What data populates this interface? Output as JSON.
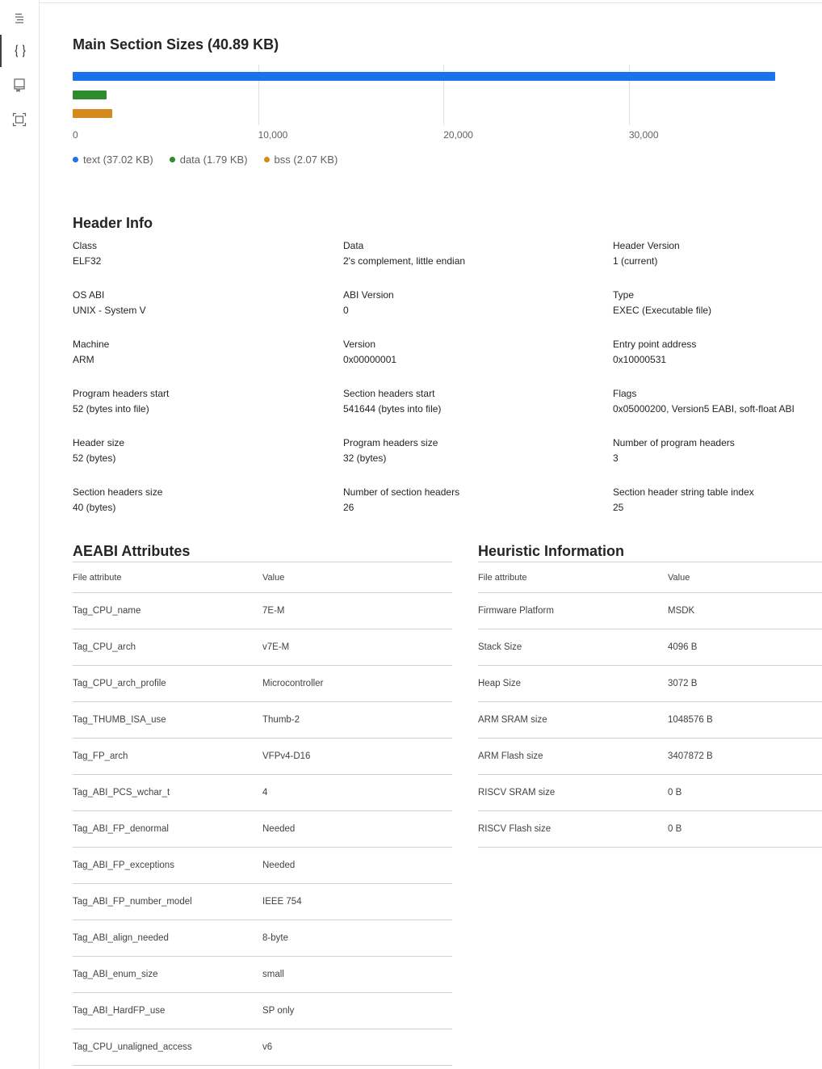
{
  "activity_bar": {
    "items": [
      {
        "name": "outline-icon"
      },
      {
        "name": "braces-icon"
      },
      {
        "name": "book-icon"
      },
      {
        "name": "fullscreen-icon"
      }
    ]
  },
  "section_sizes": {
    "title": "Main Section Sizes (40.89 KB)",
    "legend": [
      {
        "label": "text (37.02 KB)",
        "color": "#1a73e8"
      },
      {
        "label": "data (1.79 KB)",
        "color": "#2e8b2e"
      },
      {
        "label": "bss (2.07 KB)",
        "color": "#d48a1c"
      }
    ]
  },
  "chart_data": {
    "type": "bar",
    "orientation": "horizontal",
    "title": "Main Section Sizes (40.89 KB)",
    "categories": [
      "text",
      "data",
      "bss"
    ],
    "values": [
      37905,
      1833,
      2120
    ],
    "colors": [
      "#1a73e8",
      "#2e8b2e",
      "#d48a1c"
    ],
    "xlim": [
      0,
      38500
    ],
    "xticks": [
      "0",
      "10,000",
      "20,000",
      "30,000"
    ],
    "xtick_values": [
      0,
      10000,
      20000,
      30000
    ],
    "grid": true,
    "legend": "bottom-left"
  },
  "header_info": {
    "title": "Header Info",
    "fields": [
      {
        "label": "Class",
        "value": "ELF32"
      },
      {
        "label": "Data",
        "value": "2's complement, little endian"
      },
      {
        "label": "Header Version",
        "value": "1 (current)"
      },
      {
        "label": "OS ABI",
        "value": "UNIX - System V"
      },
      {
        "label": "ABI Version",
        "value": "0"
      },
      {
        "label": "Type",
        "value": "EXEC (Executable file)"
      },
      {
        "label": "Machine",
        "value": "ARM"
      },
      {
        "label": "Version",
        "value": "0x00000001"
      },
      {
        "label": "Entry point address",
        "value": "0x10000531"
      },
      {
        "label": "Program headers start",
        "value": "52 (bytes into file)"
      },
      {
        "label": "Section headers start",
        "value": "541644 (bytes into file)"
      },
      {
        "label": "Flags",
        "value": "0x05000200, Version5 EABI, soft-float ABI"
      },
      {
        "label": "Header size",
        "value": "52 (bytes)"
      },
      {
        "label": "Program headers size",
        "value": "32 (bytes)"
      },
      {
        "label": "Number of program headers",
        "value": "3"
      },
      {
        "label": "Section headers size",
        "value": "40 (bytes)"
      },
      {
        "label": "Number of section headers",
        "value": "26"
      },
      {
        "label": "Section header string table index",
        "value": "25"
      }
    ]
  },
  "aeabi": {
    "title": "AEABI Attributes",
    "headers": [
      "File attribute",
      "Value"
    ],
    "rows": [
      [
        "Tag_CPU_name",
        "7E-M"
      ],
      [
        "Tag_CPU_arch",
        "v7E-M"
      ],
      [
        "Tag_CPU_arch_profile",
        "Microcontroller"
      ],
      [
        "Tag_THUMB_ISA_use",
        "Thumb-2"
      ],
      [
        "Tag_FP_arch",
        "VFPv4-D16"
      ],
      [
        "Tag_ABI_PCS_wchar_t",
        "4"
      ],
      [
        "Tag_ABI_FP_denormal",
        "Needed"
      ],
      [
        "Tag_ABI_FP_exceptions",
        "Needed"
      ],
      [
        "Tag_ABI_FP_number_model",
        "IEEE 754"
      ],
      [
        "Tag_ABI_align_needed",
        "8-byte"
      ],
      [
        "Tag_ABI_enum_size",
        "small"
      ],
      [
        "Tag_ABI_HardFP_use",
        "SP only"
      ],
      [
        "Tag_CPU_unaligned_access",
        "v6"
      ]
    ]
  },
  "heuristic": {
    "title": "Heuristic Information",
    "headers": [
      "File attribute",
      "Value"
    ],
    "rows": [
      [
        "Firmware Platform",
        "MSDK"
      ],
      [
        "Stack Size",
        "4096 B"
      ],
      [
        "Heap Size",
        "3072 B"
      ],
      [
        "ARM SRAM size",
        "1048576 B"
      ],
      [
        "ARM Flash size",
        "3407872 B"
      ],
      [
        "RISCV SRAM size",
        "0 B"
      ],
      [
        "RISCV Flash size",
        "0 B"
      ]
    ]
  }
}
